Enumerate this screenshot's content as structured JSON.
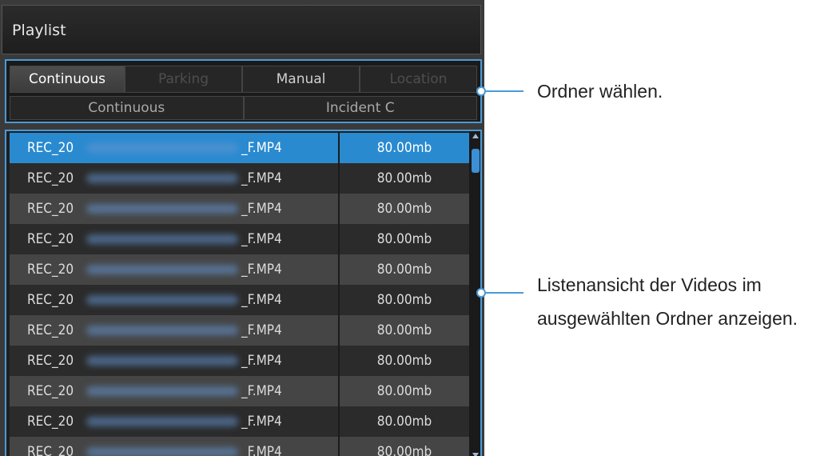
{
  "window": {
    "title": "Playlist"
  },
  "folder_tabs": {
    "row1": [
      {
        "label": "Continuous",
        "state": "active"
      },
      {
        "label": "Parking",
        "state": "disabled"
      },
      {
        "label": "Manual",
        "state": "normal"
      },
      {
        "label": "Location",
        "state": "disabled"
      }
    ],
    "row2": [
      {
        "label": "Continuous"
      },
      {
        "label": "Incident C"
      }
    ]
  },
  "files": [
    {
      "prefix": "REC_20",
      "suffix": "_F.MP4",
      "size": "80.00mb",
      "selected": true
    },
    {
      "prefix": "REC_20",
      "suffix": "_F.MP4",
      "size": "80.00mb"
    },
    {
      "prefix": "REC_20",
      "suffix": "_F.MP4",
      "size": "80.00mb"
    },
    {
      "prefix": "REC_20",
      "suffix": "_F.MP4",
      "size": "80.00mb"
    },
    {
      "prefix": "REC_20",
      "suffix": "_F.MP4",
      "size": "80.00mb"
    },
    {
      "prefix": "REC_20",
      "suffix": "_F.MP4",
      "size": "80.00mb"
    },
    {
      "prefix": "REC_20",
      "suffix": "_F.MP4",
      "size": "80.00mb"
    },
    {
      "prefix": "REC_20",
      "suffix": "_F.MP4",
      "size": "80.00mb"
    },
    {
      "prefix": "REC_20",
      "suffix": "_F.MP4",
      "size": "80.00mb"
    },
    {
      "prefix": "REC_20",
      "suffix": "_F.MP4",
      "size": "80.00mb"
    },
    {
      "prefix": "REC_20",
      "suffix": "_F.MP4",
      "size": "80.00mb"
    }
  ],
  "annotations": {
    "folder_label": "Ordner wählen.",
    "list_label_line1": "Listenansicht der Videos im",
    "list_label_line2": "ausgewählten Ordner anzeigen."
  },
  "colors": {
    "accent": "#4a9ad8",
    "selected_row": "#2a8ad0"
  },
  "icons": [
    "scroll-up-icon",
    "scroll-down-icon"
  ]
}
